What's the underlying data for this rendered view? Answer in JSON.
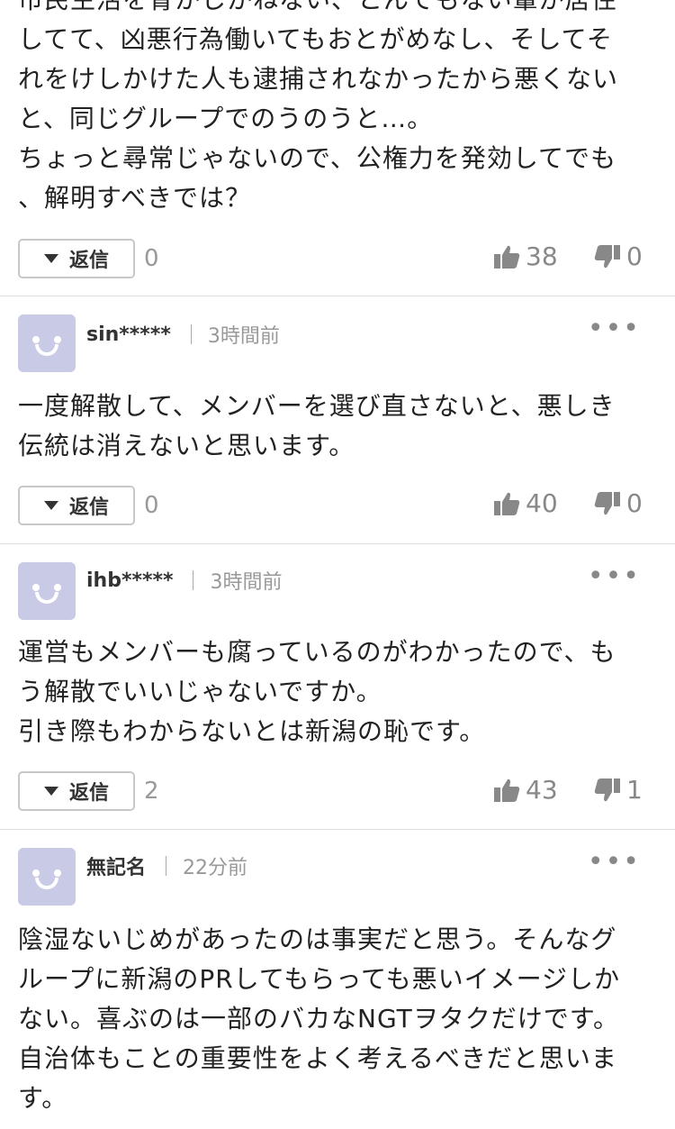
{
  "comments": [
    {
      "username": "",
      "time": "",
      "text": "市民生活を脅かしかねない、とんでもない輩が居住\nしてて、凶悪行為働いてもおとがめなし、そしてそ\nれをけしかけた人も逮捕されなかったから悪くない\nと、同じグループでのうのうと…。\nちょっと尋常じゃないので、公権力を発効してでも\n、解明すべきでは？",
      "reply_label": "返信",
      "reply_count": "0",
      "likes": "38",
      "dislikes": "0"
    },
    {
      "username": "sin*****",
      "time": "3時間前",
      "text": "一度解散して、メンバーを選び直さないと、悪しき\n伝統は消えないと思います。",
      "reply_label": "返信",
      "reply_count": "0",
      "likes": "40",
      "dislikes": "0"
    },
    {
      "username": "ihb*****",
      "time": "3時間前",
      "text": "運営もメンバーも腐っているのがわかったので、も\nう解散でいいじゃないですか。\n引き際もわからないとは新潟の恥です。",
      "reply_label": "返信",
      "reply_count": "2",
      "likes": "43",
      "dislikes": "1"
    },
    {
      "username": "無記名",
      "time": "22分前",
      "text": "陰湿ないじめがあったのは事実だと思う。そんなグ\nループに新潟のPRしてもらっても悪いイメージしか\nない。喜ぶのは一部のバカなNGTヲタクだけです。\n自治体もことの重要性をよく考えるべきだと思いま\nす。"
    }
  ],
  "icons": {
    "more": "more-icon",
    "like": "thumbs-up-icon",
    "dislike": "thumbs-down-icon",
    "reply_toggle": "caret-down-icon",
    "avatar": "default-avatar-icon"
  },
  "colors": {
    "avatar_bg": "#c9cbe6",
    "divider": "#dddddd",
    "muted_text": "#999999"
  }
}
